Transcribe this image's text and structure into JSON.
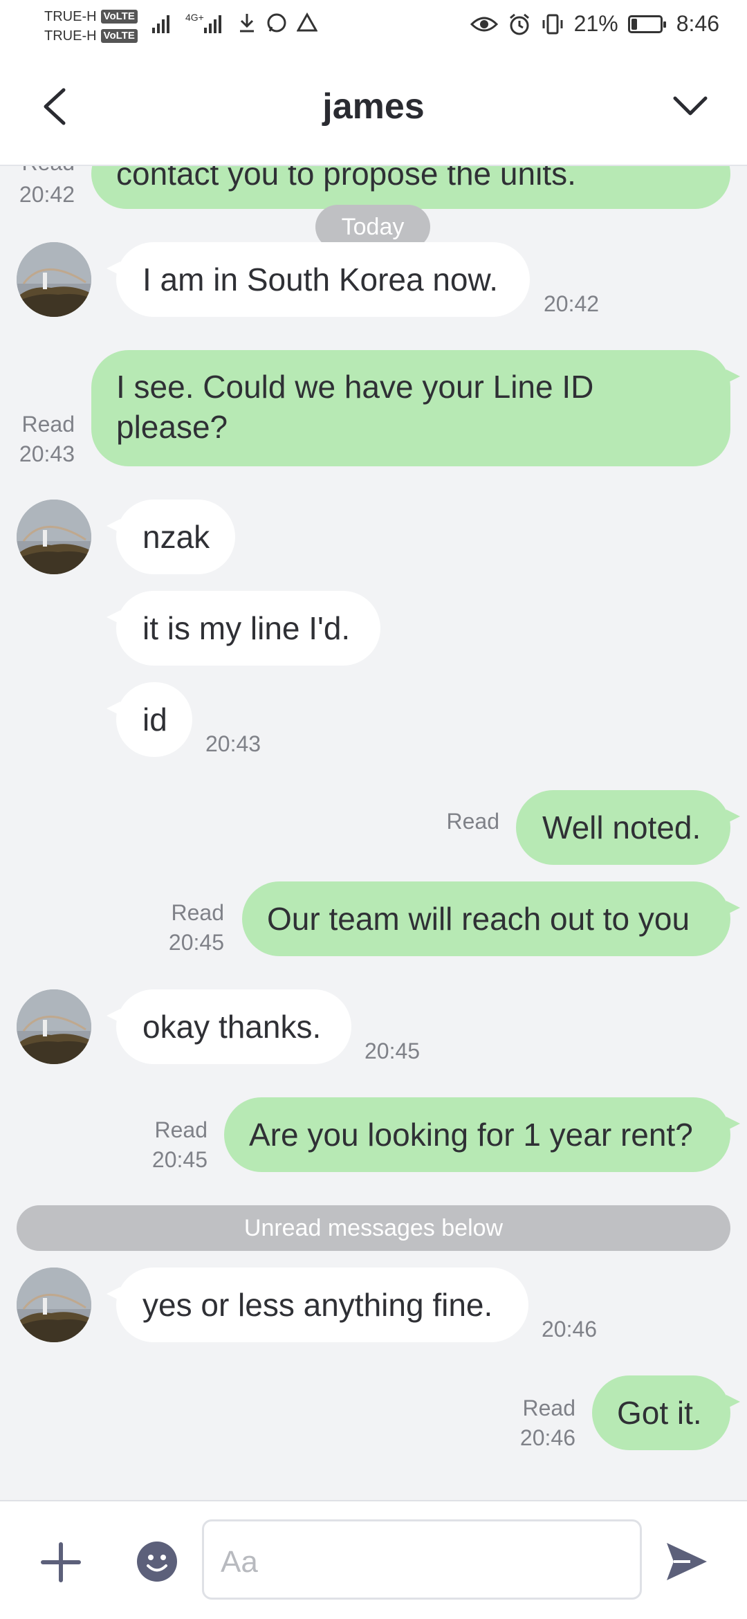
{
  "status_bar": {
    "carrier_1": "TRUE-H",
    "carrier_2": "TRUE-H",
    "volte_badge": "VoLTE",
    "network_label": "4G+",
    "battery_percent": "21%",
    "time": "8:46",
    "battery_level": 0.21
  },
  "header": {
    "title": "james"
  },
  "chat": {
    "top_partial": {
      "text": "contact you to propose the units.",
      "read_label": "Read",
      "time": "20:42"
    },
    "date_divider": "Today",
    "messages": [
      {
        "text": "I am in South Korea now.",
        "time": "20:42"
      },
      {
        "text_line1": "I see. Could we have your Line ID",
        "text_line2": "please?",
        "read_label": "Read",
        "time": "20:43"
      },
      {
        "text": "nzak"
      },
      {
        "text": "it is my line I'd."
      },
      {
        "text": "id",
        "time": "20:43"
      },
      {
        "text": "Well noted.",
        "read_label": "Read"
      },
      {
        "text": "Our team will reach out to you",
        "read_label": "Read",
        "time": "20:45"
      },
      {
        "text": "okay thanks.",
        "time": "20:45"
      },
      {
        "text": "Are you looking for 1 year rent?",
        "read_label": "Read",
        "time": "20:45"
      },
      {
        "text": "yes or less anything fine.",
        "time": "20:46"
      },
      {
        "text": "Got it.",
        "read_label": "Read",
        "time": "20:46"
      }
    ],
    "unread_divider": "Unread messages below"
  },
  "composer": {
    "placeholder": "Aa"
  },
  "icons": {
    "back": "chevron-left-icon",
    "expand": "chevron-down-icon",
    "plus": "plus-icon",
    "emoji": "emoji-icon",
    "send": "send-icon"
  },
  "colors": {
    "outgoing_bubble": "#b7e9b4",
    "incoming_bubble": "#ffffff",
    "chat_background": "#f2f3f5",
    "icon_accent": "#5c607a"
  }
}
